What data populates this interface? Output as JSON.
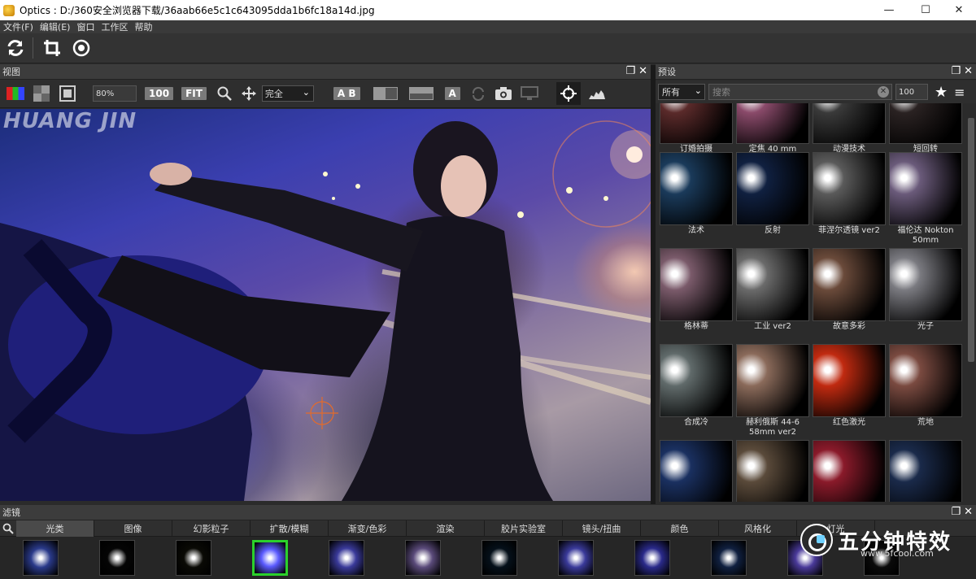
{
  "window": {
    "title": "Optics : D:/360安全浏览器下载/36aab66e5c1c643095dda1b6fc18a14d.jpg",
    "minimize": "—",
    "maximize": "☐",
    "close": "✕"
  },
  "menu": [
    "文件(F)",
    "编辑(E)",
    "窗口",
    "工作区",
    "帮助"
  ],
  "view_panel": {
    "title": "视图",
    "zoom": "80%",
    "btn_100": "100",
    "btn_fit": "FIT",
    "mode": "完全",
    "btn_ab": "A B",
    "btn_a": "A"
  },
  "image": {
    "watermark": "HUANG  JIN"
  },
  "presets_panel": {
    "title": "预设",
    "category": "所有",
    "search_placeholder": "搜索",
    "size": "100",
    "items": [
      {
        "label": "订婚拍摄",
        "color": "#5a2a2a"
      },
      {
        "label": "定焦 40 mm",
        "color": "#8a4a6a"
      },
      {
        "label": "动漫技术",
        "color": "#3a3a3a"
      },
      {
        "label": "短回转",
        "color": "#2a2222"
      },
      {
        "label": "法术",
        "color": "#1a3a5a"
      },
      {
        "label": "反射",
        "color": "#102040"
      },
      {
        "label": "菲涅尔透镜 ver2",
        "color": "#5a5a5a"
      },
      {
        "label": "福伦达 Nokton 50mm",
        "color": "#6a5a7a"
      },
      {
        "label": "格林蒂",
        "color": "#7a5a6a"
      },
      {
        "label": "工业 ver2",
        "color": "#6a6a6a"
      },
      {
        "label": "故意多彩",
        "color": "#6a4a3a"
      },
      {
        "label": "光子",
        "color": "#7a7a80"
      },
      {
        "label": "合成冷",
        "color": "#606a6a"
      },
      {
        "label": "赫利俄斯 44-6 58mm ver2",
        "color": "#8a6a5a"
      },
      {
        "label": "红色激光",
        "color": "#c02a10"
      },
      {
        "label": "荒地",
        "color": "#7a4a40"
      },
      {
        "label": "",
        "color": "#1a3060"
      },
      {
        "label": "",
        "color": "#5a4a3a"
      },
      {
        "label": "",
        "color": "#8a1a2a"
      },
      {
        "label": "",
        "color": "#1a2a4a"
      }
    ]
  },
  "filters_panel": {
    "title": "滤镜",
    "tabs": [
      "光类",
      "图像",
      "幻影粒子",
      "扩散/模糊",
      "渐变/色彩",
      "渲染",
      "胶片实验室",
      "镜头/扭曲",
      "颜色",
      "风格化",
      "灯光"
    ],
    "thumbs": [
      {
        "label": "",
        "color": "#2a3a8a"
      },
      {
        "label": "",
        "color": "#050505"
      },
      {
        "label": "",
        "color": "#0a0a05"
      },
      {
        "label": "",
        "color": "#5a5aff"
      },
      {
        "label": "",
        "color": "#3a3a9a"
      },
      {
        "label": "",
        "color": "#5a4a7a"
      },
      {
        "label": "",
        "color": "#05101a"
      },
      {
        "label": "",
        "color": "#3a3a9a"
      },
      {
        "label": "",
        "color": "#2a2a8a"
      },
      {
        "label": "",
        "color": "#102040"
      },
      {
        "label": "",
        "color": "#4a3a9a"
      },
      {
        "label": "",
        "color": "#0a0a0a"
      }
    ]
  },
  "logo": {
    "text": "五分钟特效",
    "url": "www.5fcool.com"
  }
}
